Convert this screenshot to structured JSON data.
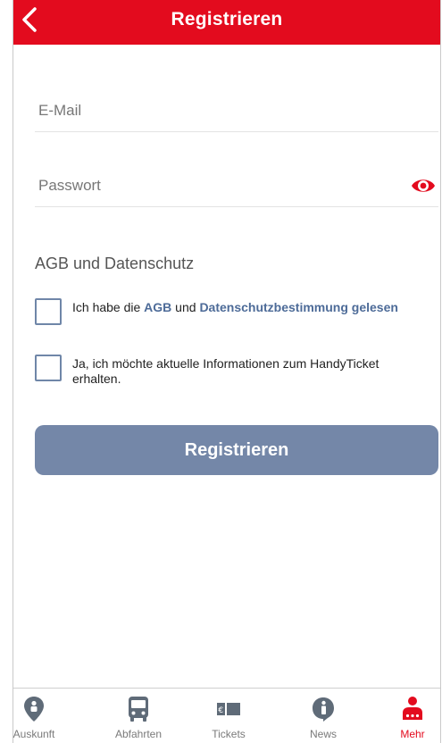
{
  "header": {
    "title": "Registrieren",
    "back_icon": "chevron-left-icon"
  },
  "form": {
    "email_placeholder": "E-Mail",
    "email_value": "",
    "password_placeholder": "Passwort",
    "password_value": "",
    "password_toggle_icon": "eye-icon"
  },
  "terms": {
    "section_title": "AGB und Datenschutz",
    "checkbox1": {
      "checked": false,
      "text_before": "Ich habe die ",
      "link_agb": "AGB",
      "text_mid": " und ",
      "link_privacy": "Datenschutzbestimmung gelesen"
    },
    "checkbox2": {
      "checked": false,
      "text": "Ja, ich möchte aktuelle Informationen zum HandyTicket erhalten."
    }
  },
  "submit_label": "Registrieren",
  "tabbar": {
    "items": [
      {
        "label": "Auskunft",
        "icon": "location-pin-icon",
        "active": false
      },
      {
        "label": "Abfahrten",
        "icon": "bus-icon",
        "active": false
      },
      {
        "label": "Tickets",
        "icon": "ticket-icon",
        "active": false
      },
      {
        "label": "News",
        "icon": "info-icon",
        "active": false
      },
      {
        "label": "Mehr",
        "icon": "person-more-icon",
        "active": true
      }
    ]
  },
  "colors": {
    "brand_red": "#e30b1e",
    "button_blue_grey": "#7487a8",
    "link_blue": "#4d6b98"
  }
}
